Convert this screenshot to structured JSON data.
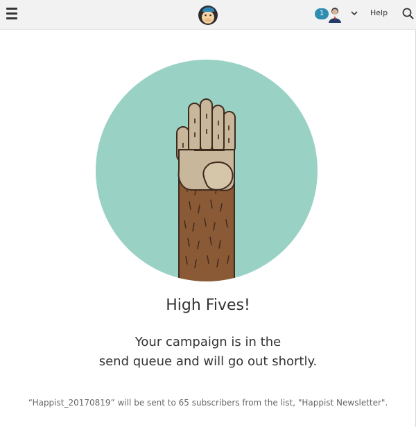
{
  "header": {
    "notification_count": "1",
    "help_label": "Help"
  },
  "illustration": {
    "circle_color": "#99d2c5",
    "hand_color": "#c9b79b",
    "arm_color": "#8a5a36"
  },
  "main": {
    "title": "High Fives!",
    "message_line1": "Your campaign is in the",
    "message_line2": "send queue and will go out shortly.",
    "footer_note": "“Happist_20170819” will be sent to 65 subscribers from the list, \"Happist Newsletter\"."
  }
}
